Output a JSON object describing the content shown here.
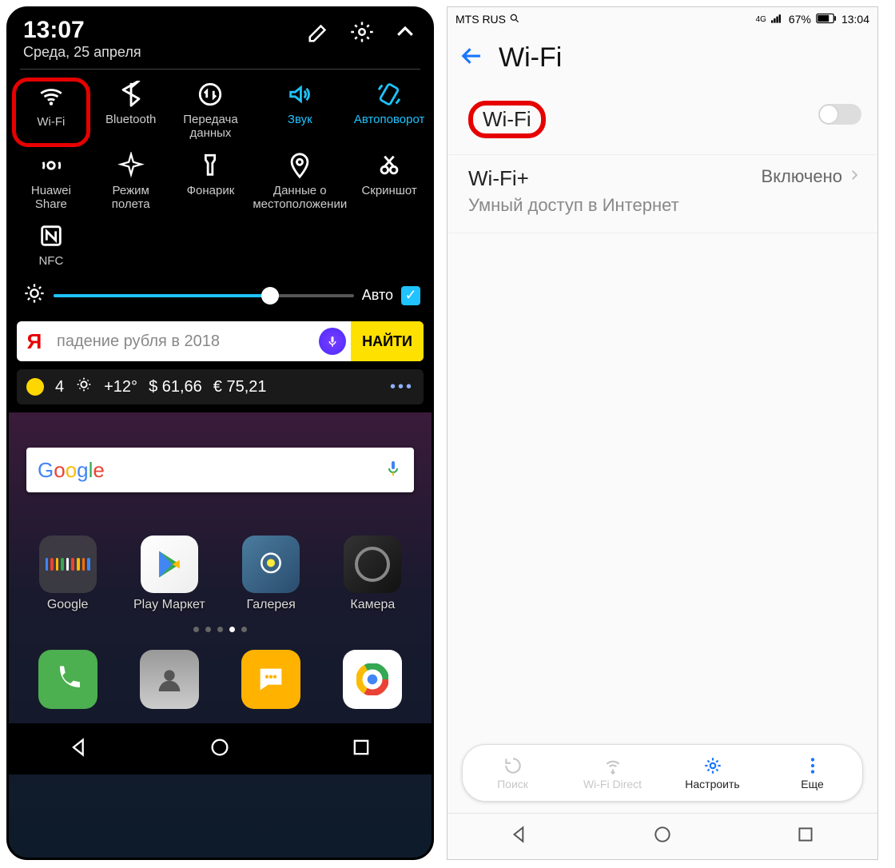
{
  "left": {
    "clock": "13:07",
    "date": "Среда, 25 апреля",
    "qs": {
      "wifi": "Wi-Fi",
      "bluetooth": "Bluetooth",
      "data": "Передача данных",
      "sound": "Звук",
      "autorotate": "Автоповорот",
      "huaweishare": "Huawei Share",
      "airplane": "Режим полета",
      "flashlight": "Фонарик",
      "location": "Данные о местоположении",
      "screenshot": "Скриншот",
      "nfc": "NFC"
    },
    "brightness_auto": "Авто",
    "search_placeholder": "падение рубля в 2018",
    "search_button": "НАЙТИ",
    "weather": {
      "night_temp": "4",
      "day_temp": "+12°",
      "usd": "$ 61,66",
      "eur": "€ 75,21"
    },
    "apps": {
      "google": "Google",
      "play": "Play Маркет",
      "gallery": "Галерея",
      "camera": "Камера"
    }
  },
  "right": {
    "carrier": "MTS RUS",
    "battery": "67%",
    "clock": "13:04",
    "net_indicator": "4G",
    "title": "Wi-Fi",
    "wifi_row": "Wi-Fi",
    "wifiplus_title": "Wi-Fi+",
    "wifiplus_sub": "Умный доступ в Интернет",
    "wifiplus_value": "Включено",
    "menu": {
      "search": "Поиск",
      "direct": "Wi-Fi Direct",
      "configure": "Настроить",
      "more": "Еще"
    }
  }
}
